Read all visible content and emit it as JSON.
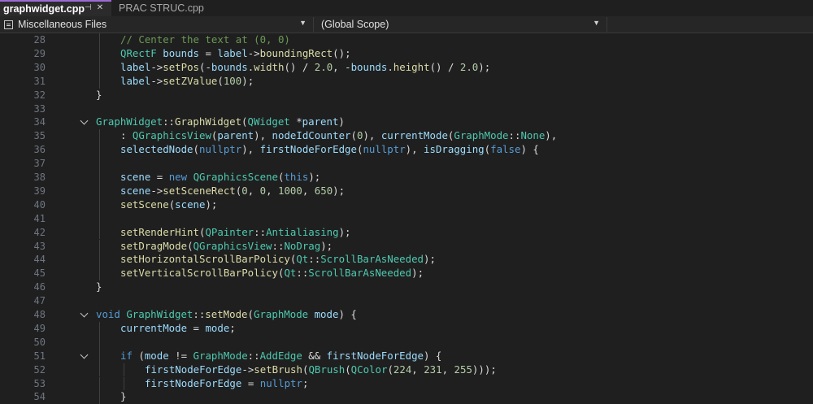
{
  "tabs": [
    {
      "label": "graphwidget.cpp",
      "active": true
    },
    {
      "label": "PRAC STRUC.cpp",
      "active": false
    }
  ],
  "tab_icons": {
    "pin": "⊣",
    "close": "✕"
  },
  "navigation": {
    "files_combo": "Miscellaneous Files",
    "scope_combo": "(Global Scope)"
  },
  "colors": {
    "keyword": "#569cd6",
    "type": "#4ec9b0",
    "function": "#dcdcaa",
    "variable": "#9cdcfe",
    "number": "#b5cea8",
    "comment": "#6a9955",
    "plain": "#dadada"
  },
  "code_lines": [
    {
      "n": "28",
      "tokens": [
        [
          "com",
          "// Center the text at (0, 0)"
        ]
      ]
    },
    {
      "n": "29",
      "tokens": [
        [
          "ty",
          "QRectF"
        ],
        [
          "pl",
          " "
        ],
        [
          "var",
          "bounds"
        ],
        [
          "pl",
          " = "
        ],
        [
          "var",
          "label"
        ],
        [
          "pl",
          "->"
        ],
        [
          "fn",
          "boundingRect"
        ],
        [
          "pl",
          "();"
        ]
      ]
    },
    {
      "n": "30",
      "tokens": [
        [
          "var",
          "label"
        ],
        [
          "pl",
          "->"
        ],
        [
          "fn",
          "setPos"
        ],
        [
          "pl",
          "(-"
        ],
        [
          "var",
          "bounds"
        ],
        [
          "pl",
          "."
        ],
        [
          "fn",
          "width"
        ],
        [
          "pl",
          "() / "
        ],
        [
          "num",
          "2.0"
        ],
        [
          "pl",
          ", -"
        ],
        [
          "var",
          "bounds"
        ],
        [
          "pl",
          "."
        ],
        [
          "fn",
          "height"
        ],
        [
          "pl",
          "() / "
        ],
        [
          "num",
          "2.0"
        ],
        [
          "pl",
          ");"
        ]
      ]
    },
    {
      "n": "31",
      "tokens": [
        [
          "var",
          "label"
        ],
        [
          "pl",
          "->"
        ],
        [
          "fn",
          "setZValue"
        ],
        [
          "pl",
          "("
        ],
        [
          "num",
          "100"
        ],
        [
          "pl",
          ");"
        ]
      ]
    },
    {
      "n": "32",
      "tokens": [
        [
          "pl",
          "}"
        ]
      ]
    },
    {
      "n": "33",
      "tokens": []
    },
    {
      "n": "34",
      "tokens": [
        [
          "ty",
          "GraphWidget"
        ],
        [
          "pl",
          "::"
        ],
        [
          "fn",
          "GraphWidget"
        ],
        [
          "pl",
          "("
        ],
        [
          "ty",
          "QWidget"
        ],
        [
          "pl",
          " *"
        ],
        [
          "var",
          "parent"
        ],
        [
          "pl",
          ")"
        ]
      ]
    },
    {
      "n": "35",
      "tokens": [
        [
          "pl",
          ": "
        ],
        [
          "ty",
          "QGraphicsView"
        ],
        [
          "pl",
          "("
        ],
        [
          "var",
          "parent"
        ],
        [
          "pl",
          "), "
        ],
        [
          "var",
          "nodeIdCounter"
        ],
        [
          "pl",
          "("
        ],
        [
          "num",
          "0"
        ],
        [
          "pl",
          "), "
        ],
        [
          "var",
          "currentMode"
        ],
        [
          "pl",
          "("
        ],
        [
          "ty",
          "GraphMode"
        ],
        [
          "pl",
          "::"
        ],
        [
          "ty",
          "None"
        ],
        [
          "pl",
          "),"
        ]
      ]
    },
    {
      "n": "36",
      "tokens": [
        [
          "var",
          "selectedNode"
        ],
        [
          "pl",
          "("
        ],
        [
          "kw",
          "nullptr"
        ],
        [
          "pl",
          "), "
        ],
        [
          "var",
          "firstNodeForEdge"
        ],
        [
          "pl",
          "("
        ],
        [
          "kw",
          "nullptr"
        ],
        [
          "pl",
          "), "
        ],
        [
          "var",
          "isDragging"
        ],
        [
          "pl",
          "("
        ],
        [
          "kw",
          "false"
        ],
        [
          "pl",
          ") {"
        ]
      ]
    },
    {
      "n": "37",
      "tokens": []
    },
    {
      "n": "38",
      "tokens": [
        [
          "var",
          "scene"
        ],
        [
          "pl",
          " = "
        ],
        [
          "kw",
          "new"
        ],
        [
          "pl",
          " "
        ],
        [
          "ty",
          "QGraphicsScene"
        ],
        [
          "pl",
          "("
        ],
        [
          "kw",
          "this"
        ],
        [
          "pl",
          ");"
        ]
      ]
    },
    {
      "n": "39",
      "tokens": [
        [
          "var",
          "scene"
        ],
        [
          "pl",
          "->"
        ],
        [
          "fn",
          "setSceneRect"
        ],
        [
          "pl",
          "("
        ],
        [
          "num",
          "0"
        ],
        [
          "pl",
          ", "
        ],
        [
          "num",
          "0"
        ],
        [
          "pl",
          ", "
        ],
        [
          "num",
          "1000"
        ],
        [
          "pl",
          ", "
        ],
        [
          "num",
          "650"
        ],
        [
          "pl",
          ");"
        ]
      ]
    },
    {
      "n": "40",
      "tokens": [
        [
          "fn",
          "setScene"
        ],
        [
          "pl",
          "("
        ],
        [
          "var",
          "scene"
        ],
        [
          "pl",
          ");"
        ]
      ]
    },
    {
      "n": "41",
      "tokens": []
    },
    {
      "n": "42",
      "tokens": [
        [
          "fn",
          "setRenderHint"
        ],
        [
          "pl",
          "("
        ],
        [
          "ty",
          "QPainter"
        ],
        [
          "pl",
          "::"
        ],
        [
          "ty",
          "Antialiasing"
        ],
        [
          "pl",
          ");"
        ]
      ]
    },
    {
      "n": "43",
      "tokens": [
        [
          "fn",
          "setDragMode"
        ],
        [
          "pl",
          "("
        ],
        [
          "ty",
          "QGraphicsView"
        ],
        [
          "pl",
          "::"
        ],
        [
          "ty",
          "NoDrag"
        ],
        [
          "pl",
          ");"
        ]
      ]
    },
    {
      "n": "44",
      "tokens": [
        [
          "fn",
          "setHorizontalScrollBarPolicy"
        ],
        [
          "pl",
          "("
        ],
        [
          "ty",
          "Qt"
        ],
        [
          "pl",
          "::"
        ],
        [
          "ty",
          "ScrollBarAsNeeded"
        ],
        [
          "pl",
          ");"
        ]
      ]
    },
    {
      "n": "45",
      "tokens": [
        [
          "fn",
          "setVerticalScrollBarPolicy"
        ],
        [
          "pl",
          "("
        ],
        [
          "ty",
          "Qt"
        ],
        [
          "pl",
          "::"
        ],
        [
          "ty",
          "ScrollBarAsNeeded"
        ],
        [
          "pl",
          ");"
        ]
      ]
    },
    {
      "n": "46",
      "tokens": [
        [
          "pl",
          "}"
        ]
      ]
    },
    {
      "n": "47",
      "tokens": []
    },
    {
      "n": "48",
      "tokens": [
        [
          "kw",
          "void"
        ],
        [
          "pl",
          " "
        ],
        [
          "ty",
          "GraphWidget"
        ],
        [
          "pl",
          "::"
        ],
        [
          "fn",
          "setMode"
        ],
        [
          "pl",
          "("
        ],
        [
          "ty",
          "GraphMode"
        ],
        [
          "pl",
          " "
        ],
        [
          "var",
          "mode"
        ],
        [
          "pl",
          ") {"
        ]
      ]
    },
    {
      "n": "49",
      "tokens": [
        [
          "var",
          "currentMode"
        ],
        [
          "pl",
          " = "
        ],
        [
          "var",
          "mode"
        ],
        [
          "pl",
          ";"
        ]
      ]
    },
    {
      "n": "50",
      "tokens": []
    },
    {
      "n": "51",
      "tokens": [
        [
          "kw",
          "if"
        ],
        [
          "pl",
          " ("
        ],
        [
          "var",
          "mode"
        ],
        [
          "pl",
          " != "
        ],
        [
          "ty",
          "GraphMode"
        ],
        [
          "pl",
          "::"
        ],
        [
          "ty",
          "AddEdge"
        ],
        [
          "pl",
          " && "
        ],
        [
          "var",
          "firstNodeForEdge"
        ],
        [
          "pl",
          ") {"
        ]
      ]
    },
    {
      "n": "52",
      "tokens": [
        [
          "var",
          "firstNodeForEdge"
        ],
        [
          "pl",
          "->"
        ],
        [
          "fn",
          "setBrush"
        ],
        [
          "pl",
          "("
        ],
        [
          "ty",
          "QBrush"
        ],
        [
          "pl",
          "("
        ],
        [
          "ty",
          "QColor"
        ],
        [
          "pl",
          "("
        ],
        [
          "num",
          "224"
        ],
        [
          "pl",
          ", "
        ],
        [
          "num",
          "231"
        ],
        [
          "pl",
          ", "
        ],
        [
          "num",
          "255"
        ],
        [
          "pl",
          ")));"
        ]
      ]
    },
    {
      "n": "53",
      "tokens": [
        [
          "var",
          "firstNodeForEdge"
        ],
        [
          "pl",
          " = "
        ],
        [
          "kw",
          "nullptr"
        ],
        [
          "pl",
          ";"
        ]
      ]
    },
    {
      "n": "54",
      "tokens": [
        [
          "pl",
          "}"
        ]
      ]
    }
  ]
}
